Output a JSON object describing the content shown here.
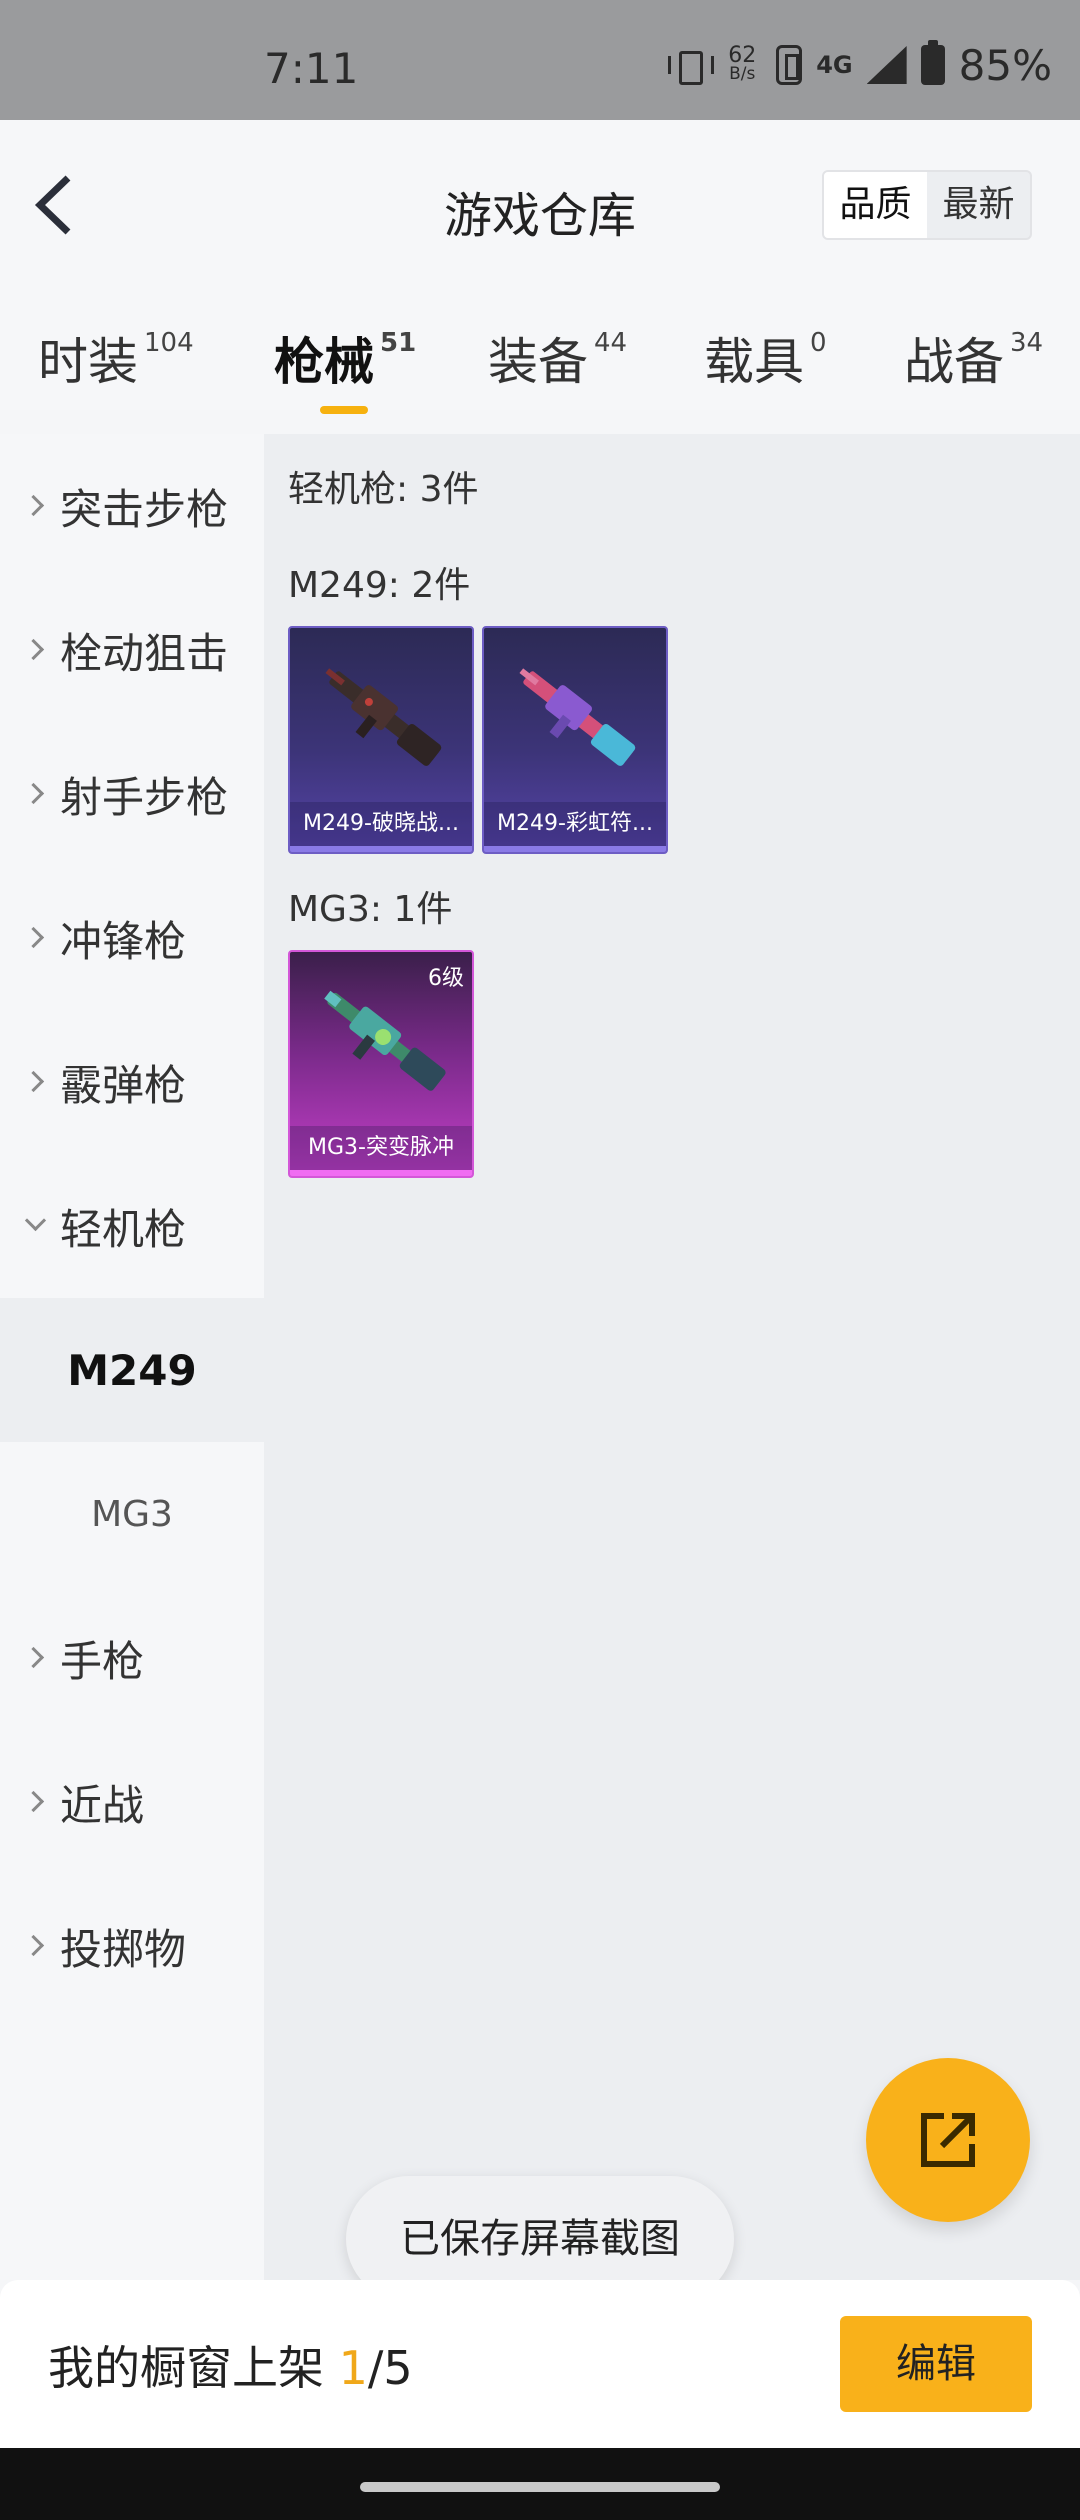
{
  "status_bar": {
    "time": "7:11",
    "net_speed_value": "62",
    "net_speed_unit": "B/s",
    "network": "4G",
    "battery": "85%"
  },
  "header": {
    "title": "游戏仓库",
    "sort_options": [
      "品质",
      "最新"
    ],
    "sort_selected": "品质"
  },
  "tabs": [
    {
      "label": "时装",
      "count": "104"
    },
    {
      "label": "枪械",
      "count": "51",
      "active": true
    },
    {
      "label": "装备",
      "count": "44"
    },
    {
      "label": "载具",
      "count": "0"
    },
    {
      "label": "战备",
      "count": "34"
    }
  ],
  "sidebar": {
    "items": [
      {
        "label": "突击步枪"
      },
      {
        "label": "栓动狙击"
      },
      {
        "label": "射手步枪"
      },
      {
        "label": "冲锋枪"
      },
      {
        "label": "霰弹枪"
      },
      {
        "label": "轻机枪",
        "expanded": true
      },
      {
        "label": "手枪"
      },
      {
        "label": "近战"
      },
      {
        "label": "投掷物"
      }
    ],
    "sub_items": [
      {
        "label": "M249",
        "active": true
      },
      {
        "label": "MG3"
      }
    ]
  },
  "content": {
    "category_summary": "轻机枪: 3件",
    "groups": [
      {
        "label": "M249: 2件",
        "items": [
          {
            "name": "M249-破晓战...",
            "rarity": "purple"
          },
          {
            "name": "M249-彩虹符...",
            "rarity": "purple"
          }
        ]
      },
      {
        "label": "MG3: 1件",
        "items": [
          {
            "name": "MG3-突变脉冲",
            "rarity": "pink",
            "level": "6级"
          }
        ]
      }
    ]
  },
  "toast": "已保存屏幕截图",
  "bottom_bar": {
    "showcase_label": "我的橱窗上架",
    "showcase_current": "1",
    "showcase_total": "/5",
    "edit_label": "编辑"
  },
  "icons": {
    "back": "back-arrow-icon",
    "fab": "share-external-icon"
  },
  "colors": {
    "accent": "#f9b11a",
    "purple_rarity": "#5644a8",
    "pink_rarity": "#c33fc8"
  }
}
